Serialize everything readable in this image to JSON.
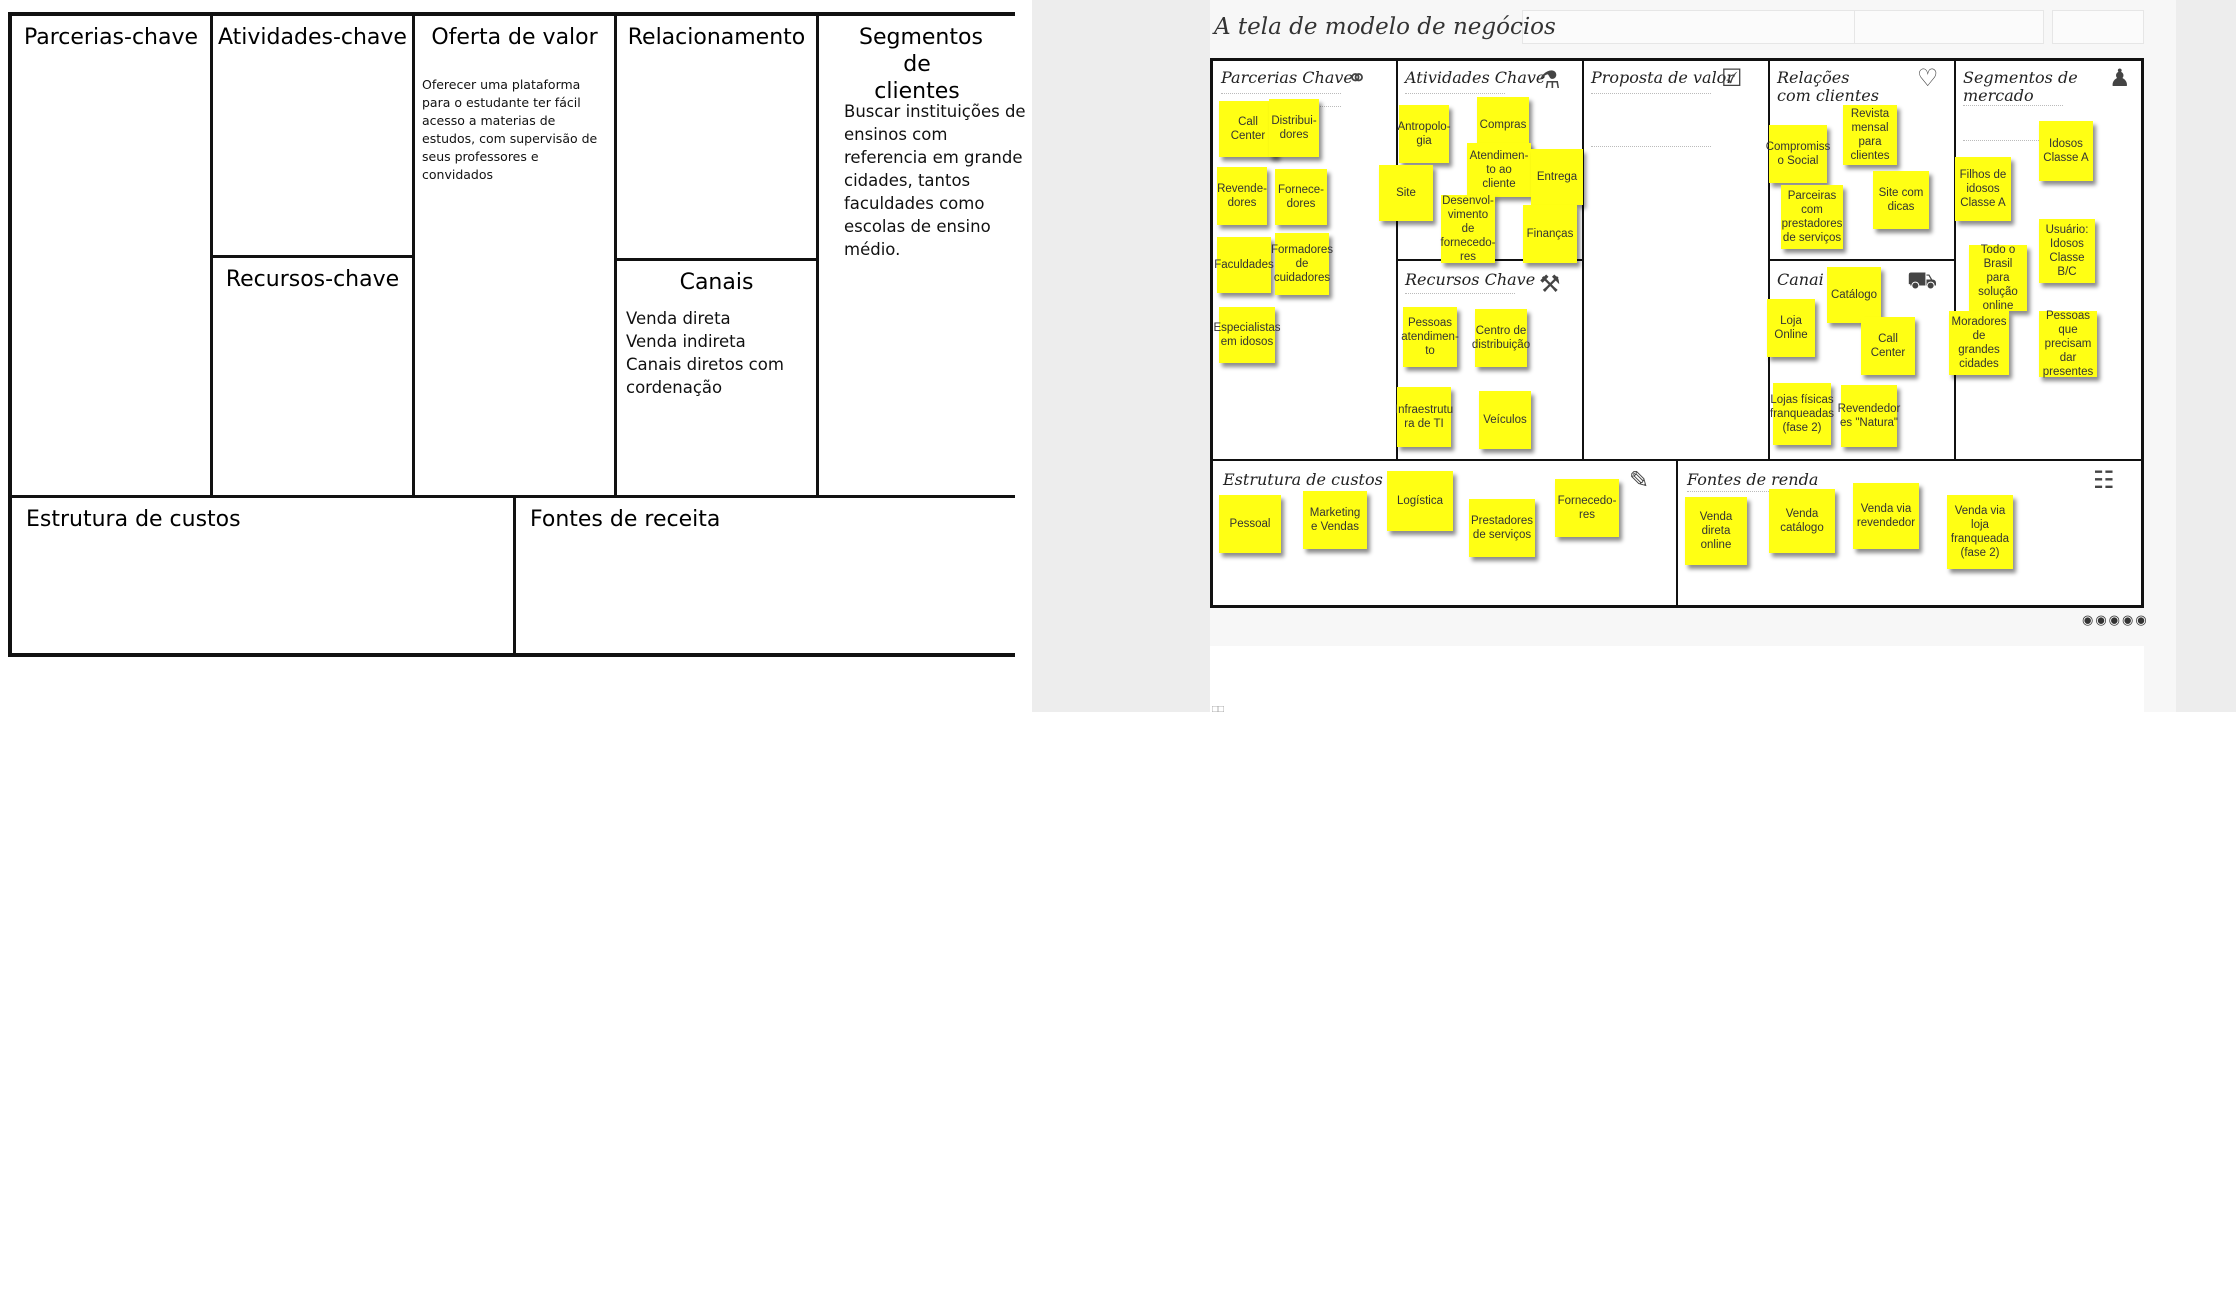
{
  "left_canvas": {
    "parcerias_title": "Parcerias-chave",
    "atividades_title": "Atividades-chave",
    "oferta_title": "Oferta de valor",
    "oferta_text": "Oferecer uma plataforma para o estudante ter fácil acesso a materias de estudos, com supervisão de seus professores e convidados",
    "relacionamento_title": "Relacionamento",
    "segmentos_title": "Segmentos de clientes",
    "segmentos_text": "Buscar instituições de ensinos com referencia em grande cidades, tantos faculdades como escolas de ensino médio.",
    "recursos_title": "Recursos-chave",
    "canais_title": "Canais",
    "canais_lines": [
      "Venda direta",
      "Venda indireta",
      "Canais diretos com cordenação"
    ],
    "custos_title": "Estrutura de custos",
    "receita_title": "Fontes de receita"
  },
  "right_panel": {
    "title": "A tela de modelo de negócios",
    "blocks": {
      "parcerias": "Parcerias Chave",
      "atividades": "Atividades Chave",
      "proposta": "Proposta de valor",
      "relacoes": "Relações com clientes",
      "segmentos": "Segmentos de mercado",
      "recursos": "Recursos Chave",
      "canais": "Canai",
      "custos": "Estrutura de custos",
      "renda": "Fontes de renda"
    },
    "stickies": {
      "s1": "Call Center",
      "s2": "Distribui-dores",
      "s3": "Revende-dores",
      "s4": "Fornece-dores",
      "s5": "Faculdades",
      "s6": "Formadores de cuidadores",
      "s7": "Especialistas em idosos",
      "s8": "Antropolo-gia",
      "s9": "Compras",
      "s10": "Atendimen-to ao cliente",
      "s11": "Site",
      "s12": "Entrega",
      "s13": "Desenvol-vimento de fornecedo-res",
      "s14": "Finanças",
      "s15": "Pessoas atendimen-to",
      "s16": "Centro de distribuição",
      "s17": "Infraestrutu ra de TI",
      "s18": "Veículos",
      "s19": "Compromiss o Social",
      "s20": "Revista mensal para clientes",
      "s21": "Parceiras com prestadores de serviços",
      "s22": "Site com dicas",
      "s23": "Catálogo",
      "s24": "Loja Online",
      "s25": "Call Center",
      "s26": "Lojas físicas franqueadas (fase 2)",
      "s27": "Revendedor es \"Natura\"",
      "s28": "Filhos de idosos Classe A",
      "s29": "Idosos Classe A",
      "s30": "Todo o Brasil para solução online",
      "s31": "Usuário: Idosos Classe B/C",
      "s32": "Moradores de grandes cidades",
      "s33": "Pessoas que precisam dar presentes",
      "s34": "Pessoal",
      "s35": "Marketing e Vendas",
      "s36": "Logística",
      "s37": "Prestadores de serviços",
      "s38": "Fornecedo-res",
      "s39": "Venda direta online",
      "s40": "Venda catálogo",
      "s41": "Venda via revendedor",
      "s42": "Venda via loja franqueada (fase 2)"
    }
  },
  "colors": {
    "sticky_yellow": "#ffff14",
    "canvas_border": "#111111",
    "panel_background": "#ededed"
  }
}
